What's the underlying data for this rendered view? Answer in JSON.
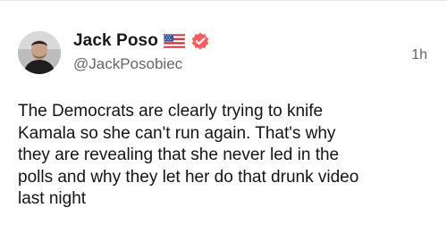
{
  "author": {
    "display_name": "Jack Poso",
    "handle": "@JackPosobiec",
    "badges": [
      "us-flag-icon",
      "verified-badge-icon"
    ],
    "verified_color": "#ff5a5f"
  },
  "post": {
    "time_ago": "1h",
    "text_lines": [
      "The Democrats are clearly trying to knife",
      "Kamala so she can't run again. That's why",
      "they are revealing that she never led in the",
      "polls and why they let her do that drunk video",
      "last night"
    ]
  }
}
